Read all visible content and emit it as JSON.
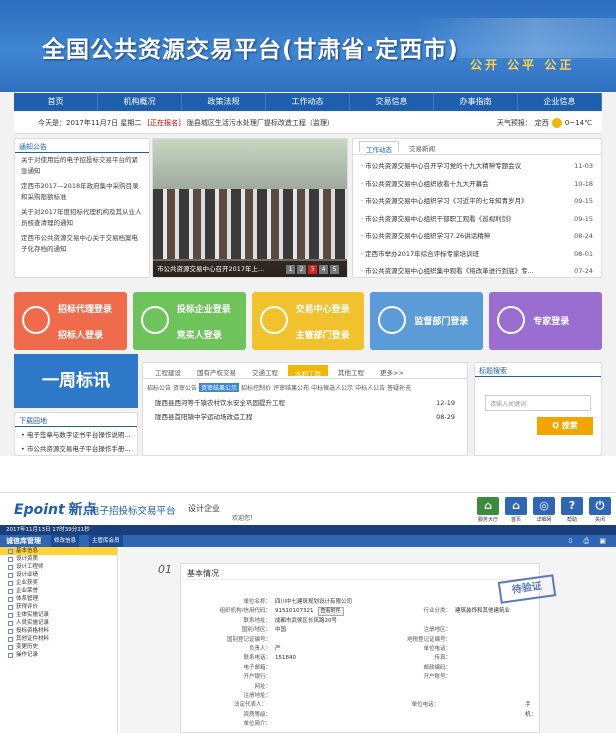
{
  "top": {
    "site_title": "全国公共资源交易平台(甘肃省·定西市)",
    "slogan": "公开 公平 公正",
    "nav": [
      "首页",
      "机构概况",
      "政策法规",
      "工作动态",
      "交易信息",
      "办事指南",
      "企业信息"
    ],
    "info": {
      "date": "今天是：2017年11月7日 星期二",
      "notice": "[正在报名]",
      "notice_text": "陇县城区生活污水处理厂提标改造工程（监理）",
      "weather_label": "天气预报：",
      "city": "定西",
      "temp": "0~14℃"
    },
    "notice_panel": {
      "title": "通知公告",
      "items": [
        "关于对使用后的电子招投标交易平台的紧急通知",
        "定西市2017—2018年政府集中采购目录和采购限额标准",
        "关于对2017年度招标代理机构及其从业人员核查清理的通知",
        "定西市公共资源交易中心关于交易档案电子化存档的通知"
      ]
    },
    "photo_caption": "市公共资源交易中心召开2017年上...",
    "photo_pages": [
      "1",
      "2",
      "3",
      "4",
      "5"
    ],
    "photo_active": "3",
    "news_panel": {
      "tabs": [
        "工作动态",
        "交易新闻"
      ],
      "items": [
        {
          "title": "市公共资源交易中心召开学习党的十九大精神专题会议",
          "date": "11-03"
        },
        {
          "title": "市公共资源交易中心组织收看十九大开幕会",
          "date": "10-18"
        },
        {
          "title": "市公共资源交易中心组织学习《习近平的七年知青岁月》",
          "date": "09-15"
        },
        {
          "title": "市公共资源交易中心组织干部职工观看《巡视利剑》",
          "date": "09-15"
        },
        {
          "title": "市公共资源交易中心组织学习7.26讲话精神",
          "date": "08-24"
        },
        {
          "title": "定西市举办2017年综合评标专家培训班",
          "date": "08-01"
        },
        {
          "title": "市公共资源交易中心组织集中观看《将改革进行到底》专...",
          "date": "07-24"
        }
      ]
    },
    "tiles": [
      {
        "l1": "招标代理登录",
        "l2": "招标人登录",
        "color": "#f06b4b"
      },
      {
        "l1": "投标企业登录",
        "l2": "竞买人登录",
        "color": "#6ec35a"
      },
      {
        "l1": "交易中心登录",
        "l2": "主管部门登录",
        "color": "#f2c12e"
      },
      {
        "lc": "监督部门登录",
        "color": "#5b9bd8"
      },
      {
        "lc": "专家登录",
        "color": "#9a6ed0"
      }
    ],
    "weekly": "一周标讯",
    "download_title": "下载园地",
    "download_items": [
      "电子签章与数字证书平台操作说明...",
      "市公共资源交易电子平台操作手册..."
    ],
    "proj": {
      "tabs": [
        "工程建设",
        "国有产权交易",
        "交通工程",
        "水利工程",
        "其他工程",
        "更多>>"
      ],
      "active_tab": "水利工程",
      "subtabs": [
        "招标公告",
        "资审公告",
        "资审结果公示",
        "招标控制价",
        "评审结果公布",
        "中标候选人公示",
        "中标人公告",
        "答疑补充"
      ],
      "active_sub": "资审结果公示",
      "rows": [
        {
          "title": "陇西县西河等千镇农村饮水安全巩固提升工程",
          "date": "12-19"
        },
        {
          "title": "陇西县首阳镇中学运动场改造工程",
          "date": "08-29"
        }
      ]
    },
    "search": {
      "title": "标题搜索",
      "placeholder": "请输入关键词",
      "button": "Q 搜索"
    }
  },
  "bottom": {
    "logo": "Epoint",
    "logo_cn": "新点",
    "title": "电子招投标交易平台",
    "sub": "设计企业",
    "welcome": "欢迎您！",
    "top_icons": [
      {
        "label": "服务大厅",
        "glyph": "⌂",
        "color": "#3b8c3b"
      },
      {
        "label": "首页",
        "glyph": "⌂",
        "color": "#2f66b3"
      },
      {
        "label": "详细网",
        "glyph": "◎",
        "color": "#2f66b3"
      },
      {
        "label": "帮助",
        "glyph": "?",
        "color": "#2f66b3"
      },
      {
        "label": "关闭",
        "glyph": "⏻",
        "color": "#2f66b3"
      }
    ],
    "datetime": "2017年11月13日 17时39分21秒",
    "menu_title": "诚信库管理",
    "menu_btns": [
      "修改信息",
      "主管库会员"
    ],
    "side_items": [
      "基本信息",
      "设计资质",
      "设计工程师",
      "设计业绩",
      "企业获奖",
      "企业荣誉",
      "体系管理",
      "获得评价",
      "主体实施记录",
      "人员实施记录",
      "投标资格材料",
      "其他证件材料",
      "变更历史",
      "操作记录"
    ],
    "num": "01",
    "section_title": "基本情况",
    "stamp": "待验证",
    "fields": [
      {
        "l": "单位名称：",
        "v": "四川中七建筑规划设计有限公司",
        "l2": "",
        "v2": ""
      },
      {
        "l": "组织机构/信用代码：",
        "v": "91510107321",
        "l2": "行业分类：",
        "v2": "建筑装饰和其他建筑业"
      },
      {
        "l": "联系地址：",
        "v": "成都市武侯区长风路20号",
        "l2": "",
        "v2": ""
      },
      {
        "l": "国别/地区：",
        "v": "中国",
        "l2": "注册地区：",
        "v2": ""
      },
      {
        "l": "国别登记证编号：",
        "v": "",
        "l2": "地税登记证编号：",
        "v2": ""
      },
      {
        "l": "负责人：",
        "v": "严",
        "l2": "单位电话：",
        "v2": ""
      },
      {
        "l": "联系电话：",
        "v": "151840",
        "l2": "传真：",
        "v2": ""
      },
      {
        "l": "电子邮箱：",
        "v": "",
        "l2": "邮政编码：",
        "v2": ""
      },
      {
        "l": "开户银行：",
        "v": "",
        "l2": "开户账号：",
        "v2": ""
      },
      {
        "l": "网址：",
        "v": "",
        "l2": "",
        "v2": ""
      },
      {
        "l": "注册地址：",
        "v": "",
        "l2": "",
        "v2": ""
      },
      {
        "l": "法定代表人：",
        "v": "",
        "l2": "单位电话：",
        "v2": ""
      },
      {
        "l": "资质等级：",
        "v": "",
        "l2": "",
        "v2": ""
      },
      {
        "l": "单位简介：",
        "v": "",
        "l2": "",
        "v2": ""
      }
    ],
    "view_btn": "查看附件",
    "mobile_label": "手机："
  }
}
